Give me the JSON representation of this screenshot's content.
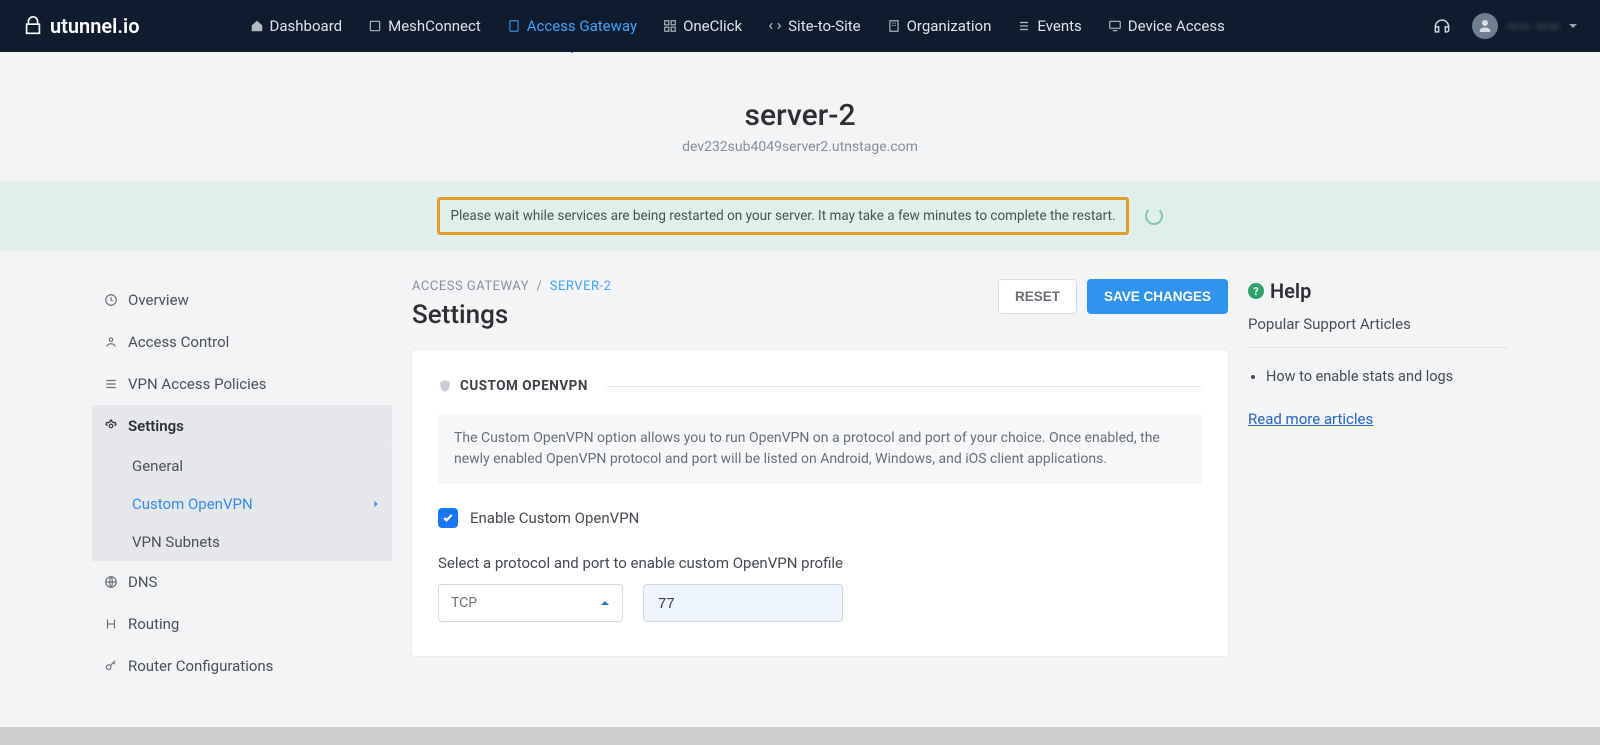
{
  "brand": "utunnel.io",
  "nav": {
    "dashboard": "Dashboard",
    "meshconnect": "MeshConnect",
    "access_gateway": "Access Gateway",
    "oneclick": "OneClick",
    "site_to_site": "Site-to-Site",
    "organization": "Organization",
    "events": "Events",
    "device_access": "Device Access"
  },
  "user_name": "—— ——",
  "server": {
    "name": "server-2",
    "host": "dev232sub4049server2.utnstage.com"
  },
  "alert_text": "Please wait while services are being restarted on your server. It may take a few minutes to complete the restart.",
  "breadcrumb": {
    "root": "ACCESS GATEWAY",
    "sep": "/",
    "current": "SERVER-2"
  },
  "page_heading": "Settings",
  "buttons": {
    "reset": "RESET",
    "save": "SAVE CHANGES"
  },
  "sidebar": {
    "overview": "Overview",
    "access_control": "Access Control",
    "vpn_policies": "VPN Access Policies",
    "settings": "Settings",
    "sub": {
      "general": "General",
      "custom_openvpn": "Custom OpenVPN",
      "vpn_subnets": "VPN Subnets"
    },
    "dns": "DNS",
    "routing": "Routing",
    "router_configs": "Router Configurations"
  },
  "card": {
    "title": "CUSTOM OPENVPN",
    "description": "The Custom OpenVPN option allows you to run OpenVPN on a protocol and port of your choice. Once enabled, the newly enabled OpenVPN protocol and port will be listed on Android, Windows, and iOS client applications.",
    "checkbox_label": "Enable Custom OpenVPN",
    "checkbox_checked": true,
    "field_label": "Select a protocol and port to enable custom OpenVPN profile",
    "protocol_value": "TCP",
    "port_value": "77"
  },
  "help": {
    "title": "Help",
    "subtitle": "Popular Support Articles",
    "article_1": "How to enable stats and logs",
    "more": "Read more articles"
  }
}
